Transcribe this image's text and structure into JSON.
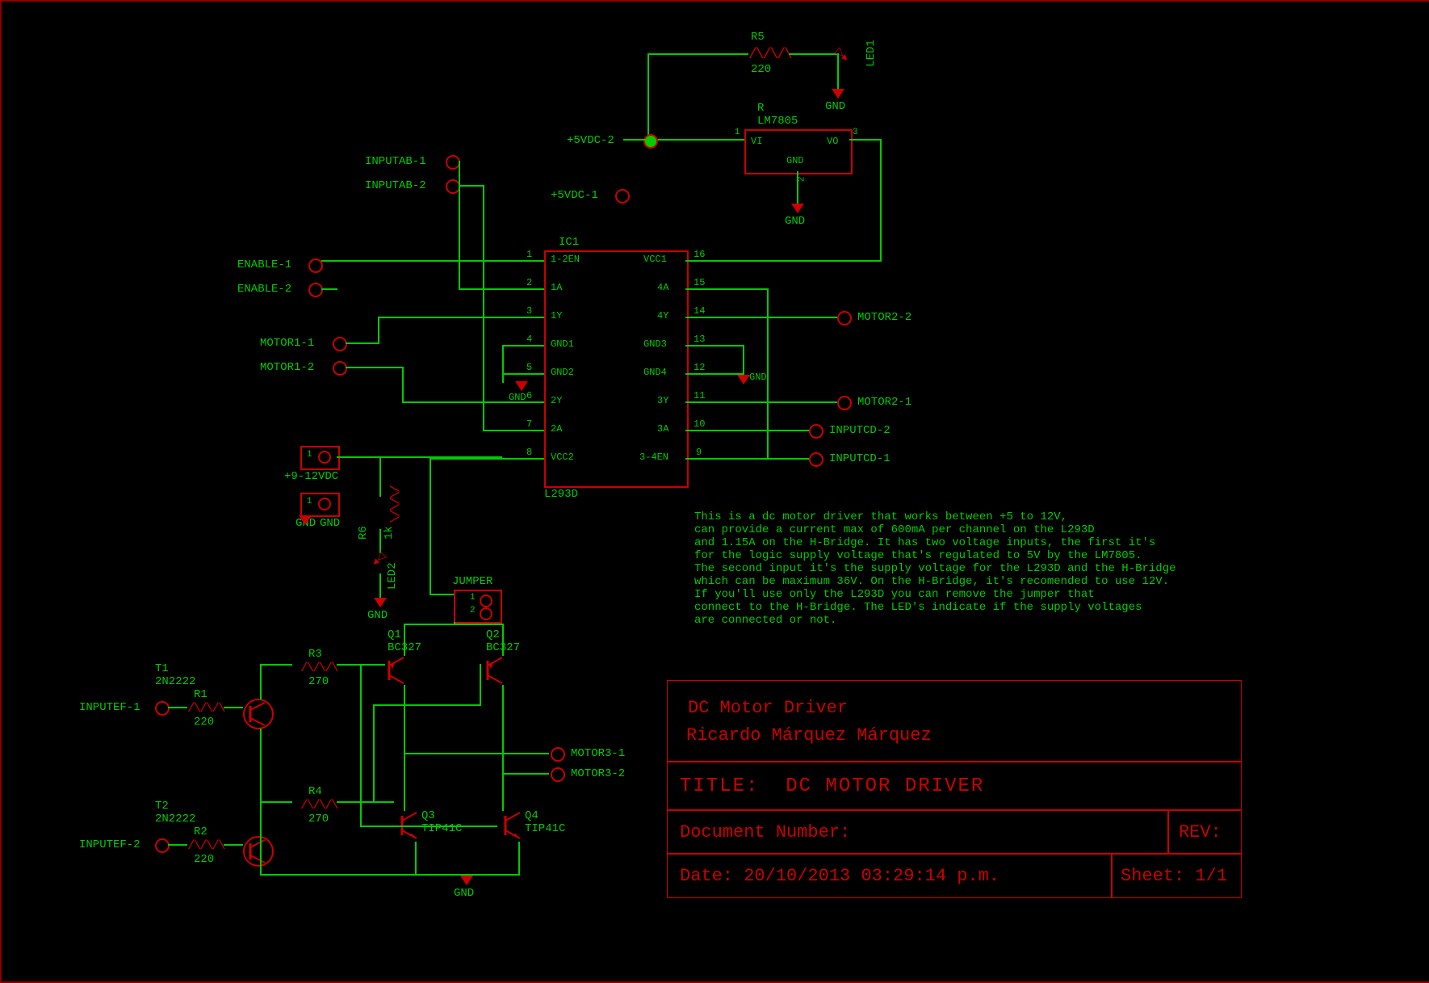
{
  "components": {
    "r5": {
      "name": "R5",
      "value": "220"
    },
    "r6": {
      "name": "R6",
      "value": "1k"
    },
    "r1": {
      "name": "R1",
      "value": "220"
    },
    "r2": {
      "name": "R2",
      "value": "220"
    },
    "r3": {
      "name": "R3",
      "value": "270"
    },
    "r4": {
      "name": "R4",
      "value": "270"
    },
    "led1": {
      "name": "LED1"
    },
    "led2": {
      "name": "LED2"
    },
    "reg": {
      "name": "R",
      "value": "LM7805",
      "pins": {
        "vi": "VI",
        "vo": "VO",
        "gnd": "GND"
      }
    },
    "ic1": {
      "name": "IC1",
      "value": "L293D",
      "pins_left": [
        {
          "n": "1",
          "l": "1-2EN"
        },
        {
          "n": "2",
          "l": "1A"
        },
        {
          "n": "3",
          "l": "1Y"
        },
        {
          "n": "4",
          "l": "GND1"
        },
        {
          "n": "5",
          "l": "GND2"
        },
        {
          "n": "6",
          "l": "2Y"
        },
        {
          "n": "7",
          "l": "2A"
        },
        {
          "n": "8",
          "l": "VCC2"
        }
      ],
      "pins_right": [
        {
          "n": "16",
          "l": "VCC1"
        },
        {
          "n": "15",
          "l": "4A"
        },
        {
          "n": "14",
          "l": "4Y"
        },
        {
          "n": "13",
          "l": "GND3"
        },
        {
          "n": "12",
          "l": "GND4"
        },
        {
          "n": "11",
          "l": "3Y"
        },
        {
          "n": "10",
          "l": "3A"
        },
        {
          "n": "9",
          "l": "3-4EN"
        }
      ]
    },
    "q1": {
      "name": "Q1",
      "value": "BC327"
    },
    "q2": {
      "name": "Q2",
      "value": "BC327"
    },
    "q3": {
      "name": "Q3",
      "value": "TIP41C"
    },
    "q4": {
      "name": "Q4",
      "value": "TIP41C"
    },
    "t1": {
      "name": "T1",
      "value": "2N2222"
    },
    "t2": {
      "name": "T2",
      "value": "2N2222"
    },
    "jumper": {
      "name": "JUMPER",
      "p1": "1",
      "p2": "2"
    }
  },
  "nets": {
    "inputab1": "INPUTAB-1",
    "inputab2": "INPUTAB-2",
    "enable1": "ENABLE-1",
    "enable2": "ENABLE-2",
    "motor11": "MOTOR1-1",
    "motor12": "MOTOR1-2",
    "motor21": "MOTOR2-1",
    "motor22": "MOTOR2-2",
    "motor31": "MOTOR3-1",
    "motor32": "MOTOR3-2",
    "inputcd1": "INPUTCD-1",
    "inputcd2": "INPUTCD-2",
    "inputef1": "INPUTEF-1",
    "inputef2": "INPUTEF-2",
    "p5vdc1": "+5VDC-1",
    "p5vdc2": "+5VDC-2",
    "p912": "+9-12VDC",
    "gnd": "GND",
    "gnd_pad": "GND"
  },
  "pad_markers": {
    "one": "1"
  },
  "description": {
    "l1": "This is a dc motor driver that works between +5 to 12V,",
    "l2": "can provide a current max of 600mA per channel on the L293D",
    "l3": " and 1.15A on the H-Bridge. It has two voltage inputs, the first it's",
    "l4": " for the logic supply voltage that's regulated to 5V by the LM7805.",
    "l5": "The second input it's the supply voltage for the L293D and the H-Bridge",
    "l6": " which can be maximum 36V. On the H-Bridge, it's recomended to use 12V.",
    "l7": "If you'll use only the L293D you can remove the jumper that",
    "l8": "connect to the H-Bridge. The LED's indicate if the supply voltages",
    "l9": "are connected or not."
  },
  "titleblock": {
    "project": "DC Motor Driver",
    "author": "Ricardo Márquez Márquez",
    "title_label": "TITLE:",
    "title_value": "DC MOTOR DRIVER",
    "doc_label": "Document Number:",
    "rev_label": "REV:",
    "date_label": "Date:",
    "date_value": "20/10/2013 03:29:14 p.m.",
    "sheet_label": "Sheet:",
    "sheet_value": "1/1"
  }
}
